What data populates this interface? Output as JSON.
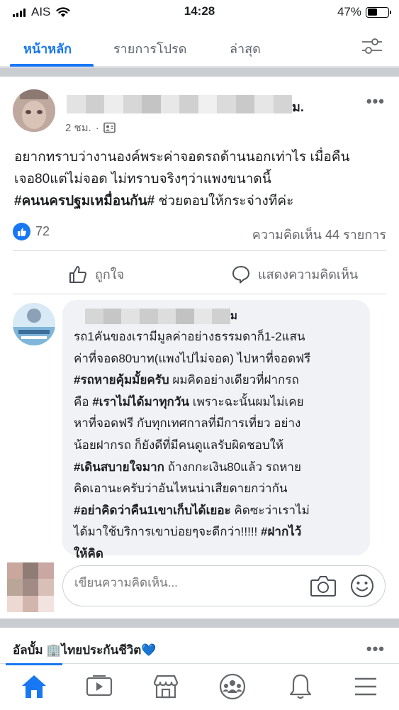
{
  "status_bar": {
    "carrier": "AIS",
    "time": "14:28",
    "battery_percent": "47%",
    "battery_level": 0.47
  },
  "top_tabs": {
    "items": [
      {
        "label": "หน้าหลัก"
      },
      {
        "label": "รายการโปรด"
      },
      {
        "label": "ล่าสุด"
      }
    ],
    "active_color": "#1877f2"
  },
  "post": {
    "author_name_tail": "ม.",
    "time": "2 ชม.",
    "text_lines": [
      "อยากทราบว่างานองค์พระค่าจอดรถด้านนอกเท่าไร เมื่อคืน",
      "เจอ80แต่ไม่จอด ไม่ทราบจริงๆว่าแพงขนาดนี้"
    ],
    "line3_hashtag": "#คนนครปฐมเหมื่อนกัน#",
    "line3_text": " ช่วยตอบให้กระจ่างทีค่ะ",
    "like_count": "72",
    "comment_count": "ความคิดเห็น 44 รายการ",
    "like_label": "ถูกใจ",
    "comment_label": "แสดงความคิดเห็น"
  },
  "comment": {
    "author_name_tail": "ม",
    "l1": "รถ1คันของเรามีมูลค่าอย่างธรรมดาก็1-2แสน",
    "l2": "ค่าที่จอด80บาท(แพงไปไม่จอด) ไปหาที่จอดฟรี",
    "l3_tag": "#รถหายคุ้มมั้ยครับ",
    "l3_text": " ผมคิดอย่างเดียวที่ฝากรถ",
    "l4_pre": "คือ ",
    "l4_tag": "#เราไม่ได้มาทุกวัน",
    "l4_text": " เพราะฉะนั้นผมไม่เคย",
    "l5": "หาที่จอดฟรี กับทุกเทศกาลที่มีการเที่ยว อย่าง",
    "l6": "น้อยฝากรถ ก็ยังดีที่มีคนดูแลรับผิดชอบให้",
    "l7_tag": "#เดินสบายใจมาก",
    "l7_text": " ถ้างกกะเงิน80แล้ว รถหาย",
    "l8": "คิดเอานะครับว่าอันไหนน่าเสียดายกว่ากัน",
    "l9_tag": "#อย่าคิดว่าคืน1เขาเก็บได้เยอะ",
    "l9_text": " คิดซะว่าเราไม่",
    "l10_text": "ได้มาใช้บริการเขาบ่อยๆจะดีกว่า!!!!! ",
    "l10_tag": "#ฝากไว้",
    "l11_tag": "ให้คิด"
  },
  "write_comment": {
    "placeholder": "เขียนความคิดเห็น..."
  },
  "next_post": {
    "title": "อัลบั้ม 🏢ไทยประกันชีวิต💙"
  },
  "bottom_nav": {
    "items": [
      "home-icon",
      "watch-icon",
      "marketplace-icon",
      "groups-icon",
      "notifications-icon",
      "menu-icon"
    ]
  }
}
